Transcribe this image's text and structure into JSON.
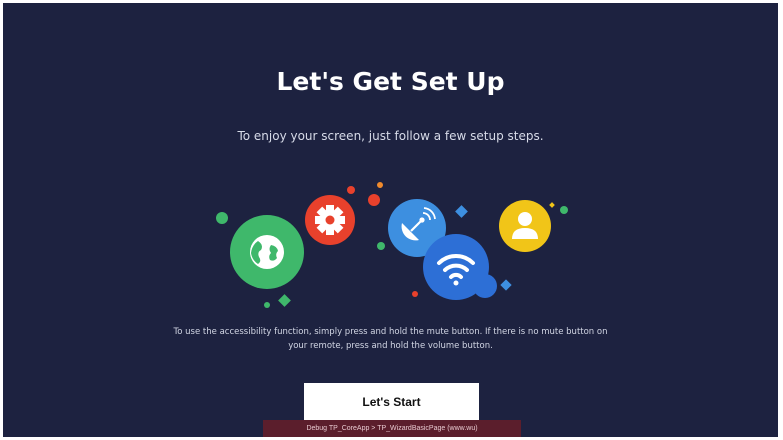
{
  "setup": {
    "title": "Let's Get Set Up",
    "subtitle": "To enjoy your screen, just follow a few setup steps.",
    "accessibility_note": "To use the accessibility function, simply press and hold the mute button. If there is no mute button on your remote, press and hold the volume button.",
    "start_button_label": "Let's Start"
  },
  "debug": {
    "text": "Debug TP_CoreApp > TP_WizardBasicPage (www.wu)"
  },
  "illustration": {
    "icons": [
      "globe-icon",
      "gear-icon",
      "satellite-icon",
      "wifi-icon",
      "user-icon"
    ]
  },
  "colors": {
    "background": "#1d2240",
    "globe": "#3fb86b",
    "gear": "#e8412c",
    "satellite": "#3d8fe0",
    "wifi": "#2d6fd6",
    "user": "#f1c518",
    "button_bg": "#ffffff",
    "debug_bar": "#5b1e2c"
  }
}
